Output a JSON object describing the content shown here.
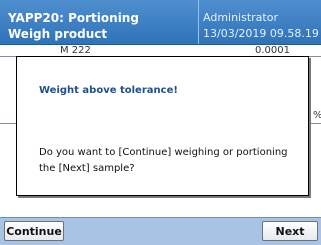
{
  "header": {
    "title_line1": "YAPP20: Portioning",
    "title_line2": "Weigh product",
    "user": "Administrator",
    "datetime": "13/03/2019 09.58.19"
  },
  "background": {
    "fragment_left": "M   222",
    "fragment_right": "  0.0001",
    "fragment_edge": "%"
  },
  "dialog": {
    "title": "Weight above tolerance!",
    "message": "Do you want to [Continue] weighing or portioning the [Next] sample?"
  },
  "footer": {
    "continue_label": "Continue",
    "next_label": "Next"
  }
}
